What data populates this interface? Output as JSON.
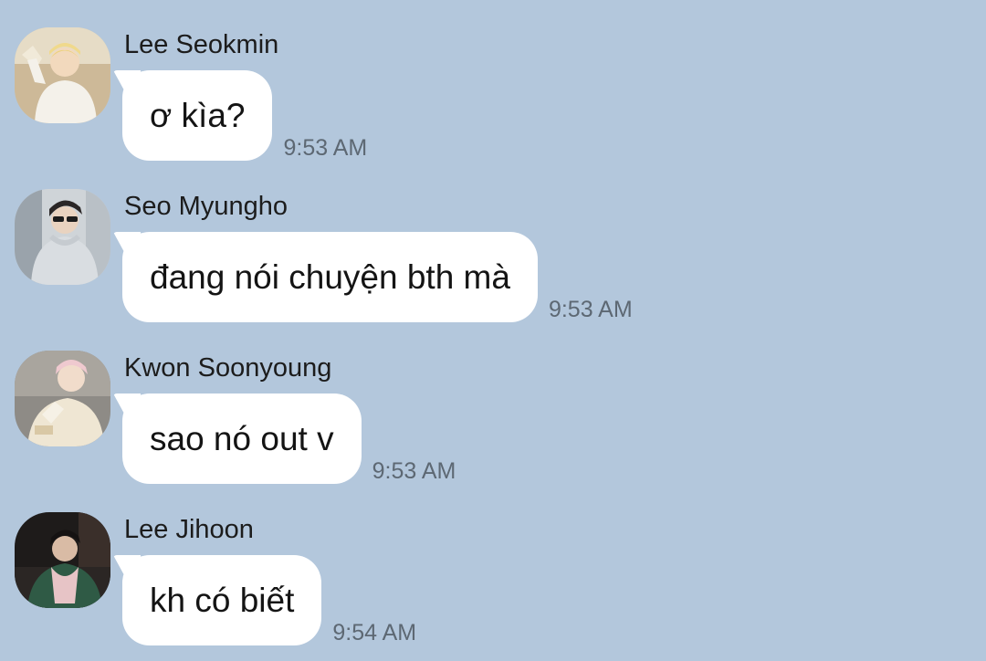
{
  "chat": {
    "background": "#b3c7dc",
    "bubble_color": "#ffffff",
    "messages": [
      {
        "sender": "Lee Seokmin",
        "text": "ơ kìa?",
        "time": "9:53 AM",
        "avatar": "avatar-photo-blond-boy-white-sweater"
      },
      {
        "sender": "Seo Myungho",
        "text": "đang nói chuyện bth mà",
        "time": "9:53 AM",
        "avatar": "avatar-photo-boy-sunglasses-grey-hoodie"
      },
      {
        "sender": "Kwon Soonyoung",
        "text": "sao nó out v",
        "time": "9:53 AM",
        "avatar": "avatar-photo-pink-hair-boy"
      },
      {
        "sender": "Lee Jihoon",
        "text": "kh có biết",
        "time": "9:54 AM",
        "avatar": "avatar-photo-boy-dark-room"
      }
    ]
  }
}
